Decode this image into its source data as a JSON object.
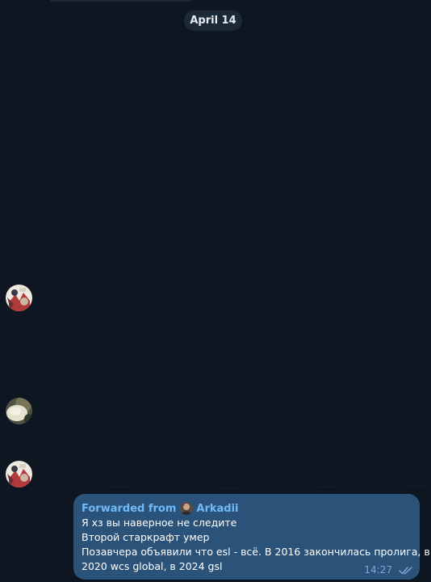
{
  "date_separator": "April 14",
  "avatars": [
    {
      "icon": "sticker-avatar-icon",
      "colors": [
        "#f2ede6",
        "#b23a3a",
        "#3a3a44"
      ]
    },
    {
      "icon": "photo-avatar-icon",
      "colors": [
        "#6b6a52",
        "#e8e2d0",
        "#2d3a2a"
      ]
    },
    {
      "icon": "sticker-avatar-icon",
      "colors": [
        "#f2ede6",
        "#b23a3a",
        "#3a3a44"
      ]
    }
  ],
  "message": {
    "forwarded_prefix": "Forwarded from",
    "forwarded_name": "Arkadii",
    "lines": [
      "Я хз вы наверное не следите",
      "Второй старкрафт умер",
      "Позавчера объявили что esl - всё. В 2016 закончилась пролига, в",
      "2020 wcs global, в 2024 gsl"
    ],
    "time": "14:27",
    "status_icon": "double-check-icon"
  },
  "colors": {
    "background": "#0e1621",
    "bubble": "#2b5278",
    "forward_accent": "#71baf9",
    "date_pill": "#1c2a38",
    "meta": "#7da8d3"
  }
}
